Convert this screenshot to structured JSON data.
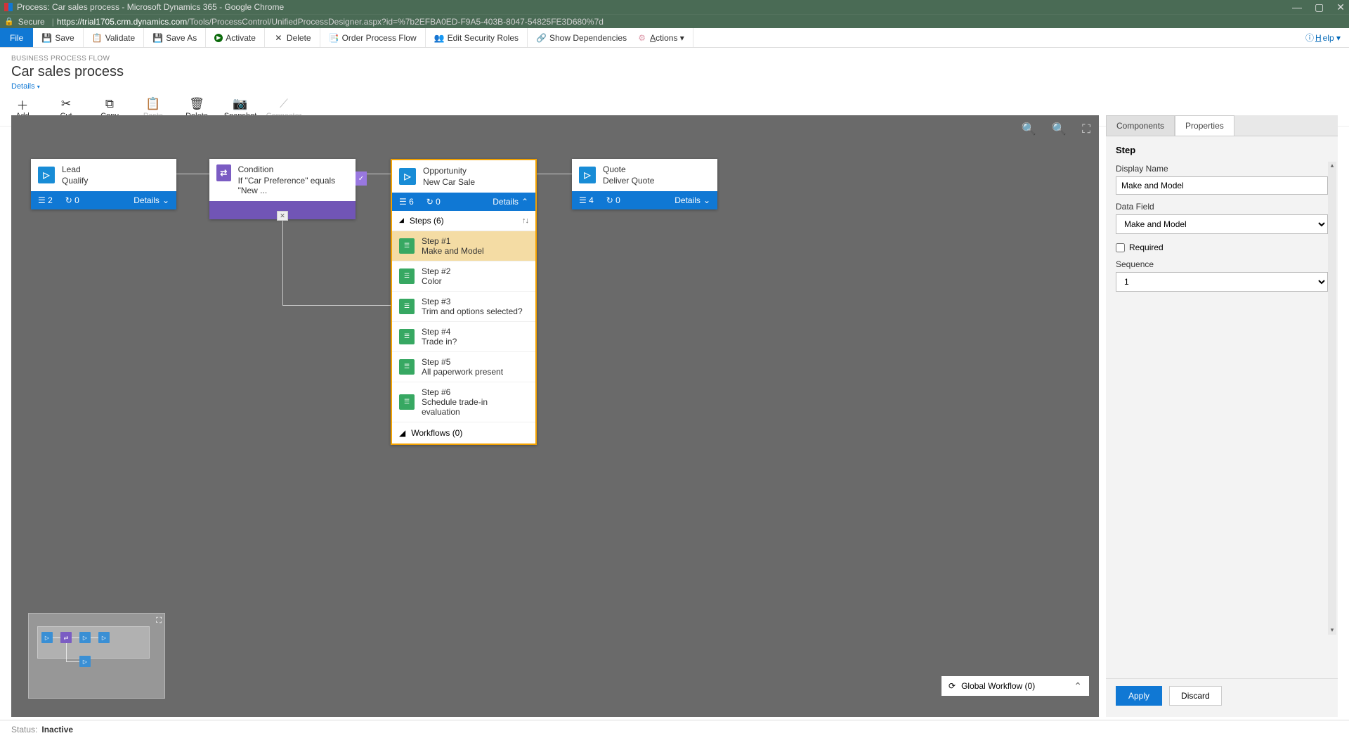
{
  "window": {
    "title": "Process: Car sales process - Microsoft Dynamics 365 - Google Chrome",
    "secure_label": "Secure",
    "url_host": "https://trial1705.crm.dynamics.com",
    "url_path": "/Tools/ProcessControl/UnifiedProcessDesigner.aspx?id=%7b2EFBA0ED-F9A5-403B-8047-54825FE3D680%7d"
  },
  "ribbon": {
    "file": "File",
    "save": "Save",
    "validate": "Validate",
    "save_as": "Save As",
    "activate": "Activate",
    "delete": "Delete",
    "order": "Order Process Flow",
    "security": "Edit Security Roles",
    "dependencies": "Show Dependencies",
    "actions": "Actions",
    "help": "Help"
  },
  "header": {
    "crumb": "BUSINESS PROCESS FLOW",
    "title": "Car sales process",
    "details": "Details"
  },
  "tools": {
    "add": "Add",
    "cut": "Cut",
    "copy": "Copy",
    "paste": "Paste",
    "delete": "Delete",
    "snapshot": "Snapshot",
    "connector": "Connector"
  },
  "stages": {
    "lead": {
      "title": "Lead",
      "sub": "Qualify",
      "steps_n": "2",
      "wf_n": "0",
      "details": "Details"
    },
    "condition": {
      "title": "Condition",
      "sub": "If \"Car Preference\" equals \"New ..."
    },
    "opportunity": {
      "title": "Opportunity",
      "sub": "New Car Sale",
      "steps_n": "6",
      "wf_n": "0",
      "details": "Details"
    },
    "quote": {
      "title": "Quote",
      "sub": "Deliver Quote",
      "steps_n": "4",
      "wf_n": "0",
      "details": "Details"
    }
  },
  "steps_header": "Steps (6)",
  "workflows_header": "Workflows (0)",
  "steps": [
    {
      "num": "Step #1",
      "name": "Make and Model"
    },
    {
      "num": "Step #2",
      "name": "Color"
    },
    {
      "num": "Step #3",
      "name": "Trim and options selected?"
    },
    {
      "num": "Step #4",
      "name": "Trade in?"
    },
    {
      "num": "Step #5",
      "name": "All paperwork present"
    },
    {
      "num": "Step #6",
      "name": "Schedule trade-in evaluation"
    }
  ],
  "global_workflow": "Global Workflow (0)",
  "panel": {
    "tab_components": "Components",
    "tab_properties": "Properties",
    "section": "Step",
    "display_name_label": "Display Name",
    "display_name_value": "Make and Model",
    "data_field_label": "Data Field",
    "data_field_value": "Make and Model",
    "required_label": "Required",
    "sequence_label": "Sequence",
    "sequence_value": "1",
    "apply": "Apply",
    "discard": "Discard"
  },
  "status": {
    "label": "Status:",
    "value": "Inactive"
  }
}
